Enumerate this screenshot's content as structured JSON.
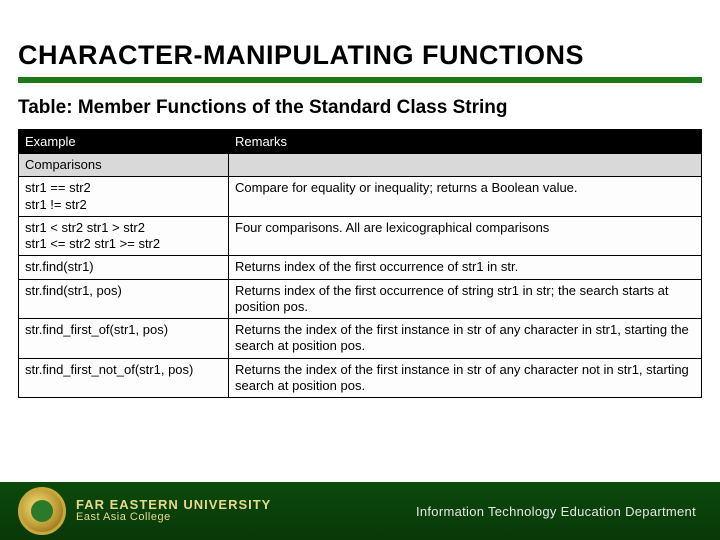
{
  "title": "CHARACTER-MANIPULATING FUNCTIONS",
  "subtitle": "Table: Member Functions of the Standard Class String",
  "table": {
    "headers": {
      "example": "Example",
      "remarks": "Remarks"
    },
    "section_label": "Comparisons",
    "rows": [
      {
        "example": "str1 == str2\nstr1 != str2",
        "remarks": "Compare for equality or inequality; returns a Boolean value."
      },
      {
        "example": "str1 < str2 str1 > str2\nstr1 <= str2     str1 >= str2",
        "remarks": "Four comparisons. All are lexicographical comparisons"
      },
      {
        "example": "str.find(str1)",
        "remarks": "Returns index of the first occurrence of str1 in str."
      },
      {
        "example": "str.find(str1, pos)",
        "remarks": "Returns index of the first occurrence of string str1 in str; the search starts at position pos."
      },
      {
        "example": "str.find_first_of(str1, pos)",
        "remarks": "Returns the index of the first instance in str of any character in str1, starting the search at position pos."
      },
      {
        "example": "str.find_first_not_of(str1, pos)",
        "remarks": "Returns the index of the first instance in str of any character not in str1, starting search at position pos."
      }
    ]
  },
  "footer": {
    "university": "FAR EASTERN UNIVERSITY",
    "college": "East Asia College",
    "department": "Information Technology Education Department"
  }
}
